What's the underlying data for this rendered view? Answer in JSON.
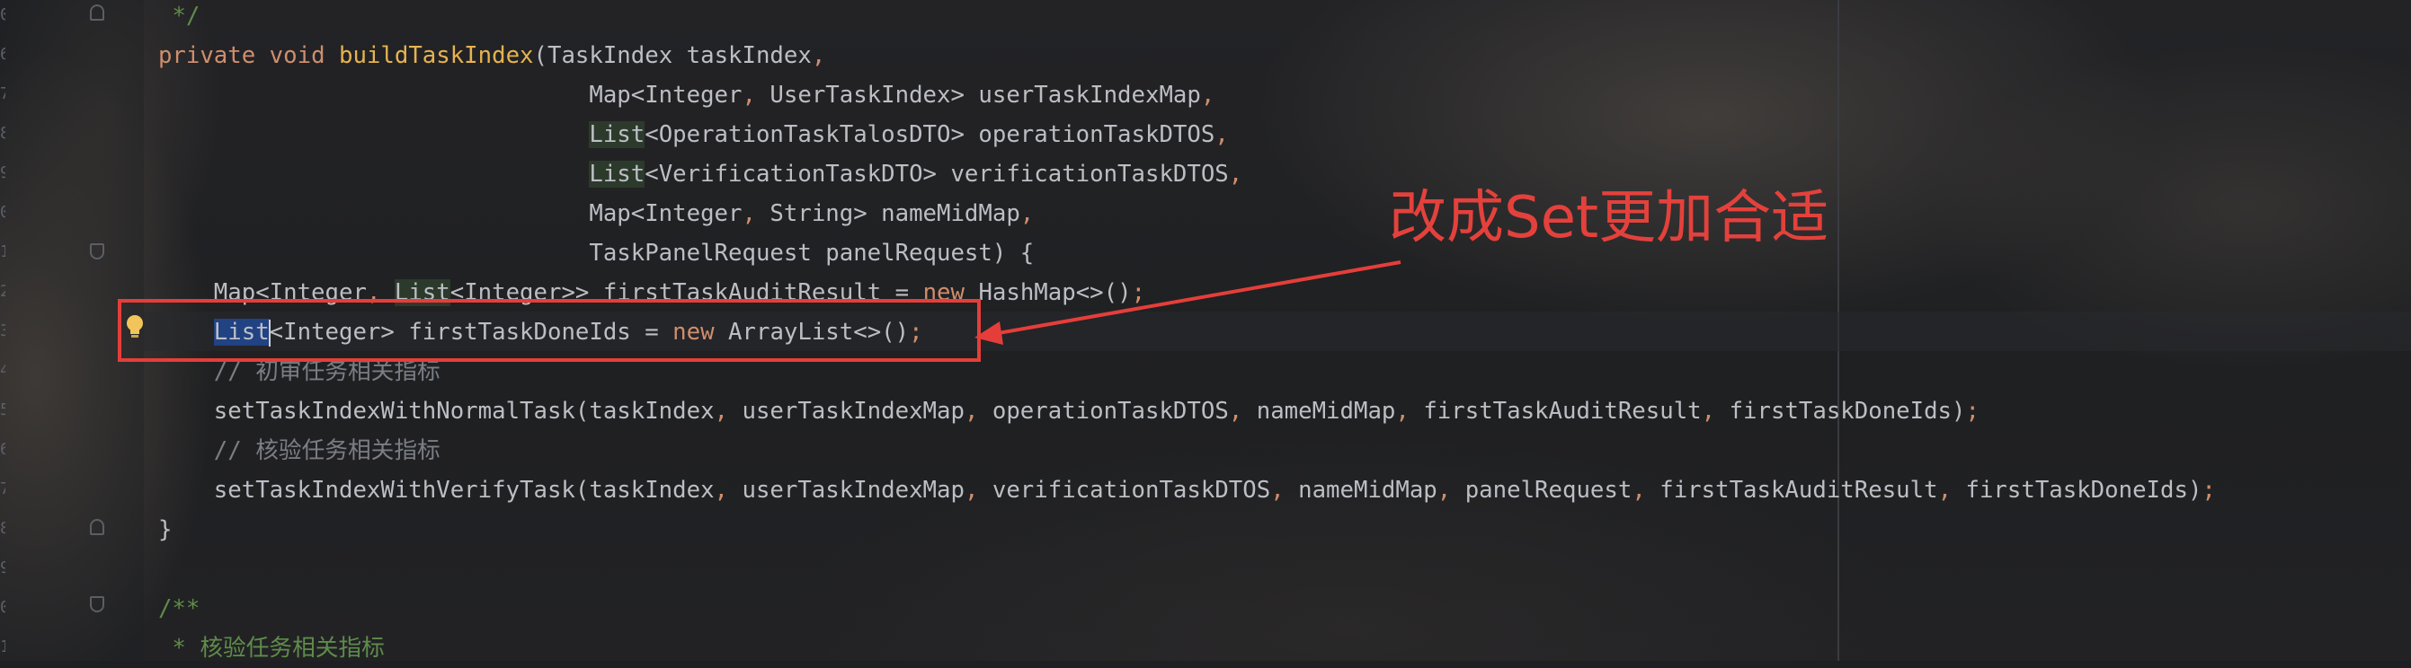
{
  "editor": {
    "line_numbers": [
      "0",
      "6",
      "7",
      "8",
      "9",
      "0",
      "1",
      "2",
      "3",
      "4",
      "5",
      "6",
      "7",
      "8",
      "9",
      "0",
      "1"
    ],
    "code_lines": [
      {
        "indent": "   ",
        "tokens": [
          {
            "t": "*/",
            "c": "dc"
          }
        ]
      },
      {
        "indent": "  ",
        "tokens": [
          {
            "t": "private ",
            "c": "kw"
          },
          {
            "t": "void ",
            "c": "kw"
          },
          {
            "t": "buildTaskIndex",
            "c": "fnd"
          },
          {
            "t": "(TaskIndex taskIndex"
          },
          {
            "t": ",",
            "c": "kw"
          }
        ]
      },
      {
        "indent": "                                 ",
        "tokens": [
          {
            "t": "Map<Integer"
          },
          {
            "t": ", ",
            "c": "kw"
          },
          {
            "t": "UserTaskIndex> userTaskIndexMap"
          },
          {
            "t": ",",
            "c": "kw"
          }
        ]
      },
      {
        "indent": "                                 ",
        "tokens": [
          {
            "t": "List",
            "c": "hl"
          },
          {
            "t": "<OperationTaskTalosDTO> operationTaskDTOS"
          },
          {
            "t": ",",
            "c": "kw"
          }
        ]
      },
      {
        "indent": "                                 ",
        "tokens": [
          {
            "t": "List",
            "c": "hl"
          },
          {
            "t": "<VerificationTaskDTO> verificationTaskDTOS"
          },
          {
            "t": ",",
            "c": "kw"
          }
        ]
      },
      {
        "indent": "                                 ",
        "tokens": [
          {
            "t": "Map<Integer"
          },
          {
            "t": ", ",
            "c": "kw"
          },
          {
            "t": "String> nameMidMap"
          },
          {
            "t": ",",
            "c": "kw"
          }
        ]
      },
      {
        "indent": "                                 ",
        "tokens": [
          {
            "t": "TaskPanelRequest panelRequest) {"
          }
        ]
      },
      {
        "indent": "      ",
        "tokens": [
          {
            "t": "Map<Integer"
          },
          {
            "t": ", ",
            "c": "kw"
          },
          {
            "t": "List",
            "c": "hl"
          },
          {
            "t": "<Integer>> firstTaskAuditResult = "
          },
          {
            "t": "new ",
            "c": "kw"
          },
          {
            "t": "HashMap<>()"
          },
          {
            "t": ";",
            "c": "kw"
          }
        ]
      },
      {
        "indent": "      ",
        "tokens": [
          {
            "t": "List",
            "c": "sel"
          },
          {
            "t": "",
            "c": "caret"
          },
          {
            "t": "<Integer> firstTaskDoneIds = "
          },
          {
            "t": "new ",
            "c": "kw"
          },
          {
            "t": "ArrayList<>()"
          },
          {
            "t": ";",
            "c": "kw"
          }
        ]
      },
      {
        "indent": "      ",
        "tokens": [
          {
            "t": "// 初审任务相关指标",
            "c": "cm"
          }
        ]
      },
      {
        "indent": "      ",
        "tokens": [
          {
            "t": "setTaskIndexWithNormalTask(taskIndex"
          },
          {
            "t": ", ",
            "c": "kw"
          },
          {
            "t": "userTaskIndexMap"
          },
          {
            "t": ", ",
            "c": "kw"
          },
          {
            "t": "operationTaskDTOS"
          },
          {
            "t": ", ",
            "c": "kw"
          },
          {
            "t": "nameMidMap"
          },
          {
            "t": ", ",
            "c": "kw"
          },
          {
            "t": "firstTaskAuditResult"
          },
          {
            "t": ", ",
            "c": "kw"
          },
          {
            "t": "firstTaskDoneIds)"
          },
          {
            "t": ";",
            "c": "kw"
          }
        ]
      },
      {
        "indent": "      ",
        "tokens": [
          {
            "t": "// 核验任务相关指标",
            "c": "cm"
          }
        ]
      },
      {
        "indent": "      ",
        "tokens": [
          {
            "t": "setTaskIndexWithVerifyTask(taskIndex"
          },
          {
            "t": ", ",
            "c": "kw"
          },
          {
            "t": "userTaskIndexMap"
          },
          {
            "t": ", ",
            "c": "kw"
          },
          {
            "t": "verificationTaskDTOS"
          },
          {
            "t": ", ",
            "c": "kw"
          },
          {
            "t": "nameMidMap"
          },
          {
            "t": ", ",
            "c": "kw"
          },
          {
            "t": "panelRequest"
          },
          {
            "t": ", ",
            "c": "kw"
          },
          {
            "t": "firstTaskAuditResult"
          },
          {
            "t": ", ",
            "c": "kw"
          },
          {
            "t": "firstTaskDoneIds)"
          },
          {
            "t": ";",
            "c": "kw"
          }
        ]
      },
      {
        "indent": "  ",
        "tokens": [
          {
            "t": "}"
          }
        ]
      },
      {
        "indent": "",
        "tokens": []
      },
      {
        "indent": "  ",
        "tokens": [
          {
            "t": "/**",
            "c": "dc"
          }
        ]
      },
      {
        "indent": "   ",
        "tokens": [
          {
            "t": "* 核验任务相关指标",
            "c": "dc"
          }
        ]
      }
    ]
  },
  "annotation": {
    "text": "改成Set更加合适",
    "color": "#e4413c"
  },
  "colors": {
    "background": "#1e1f22",
    "keyword": "#cf8e6d",
    "method_decl": "#e6b34f",
    "comment": "#7a7e85",
    "doc_comment": "#5f8c4a",
    "selection": "#214283",
    "annotation_red": "#e53e3a"
  }
}
